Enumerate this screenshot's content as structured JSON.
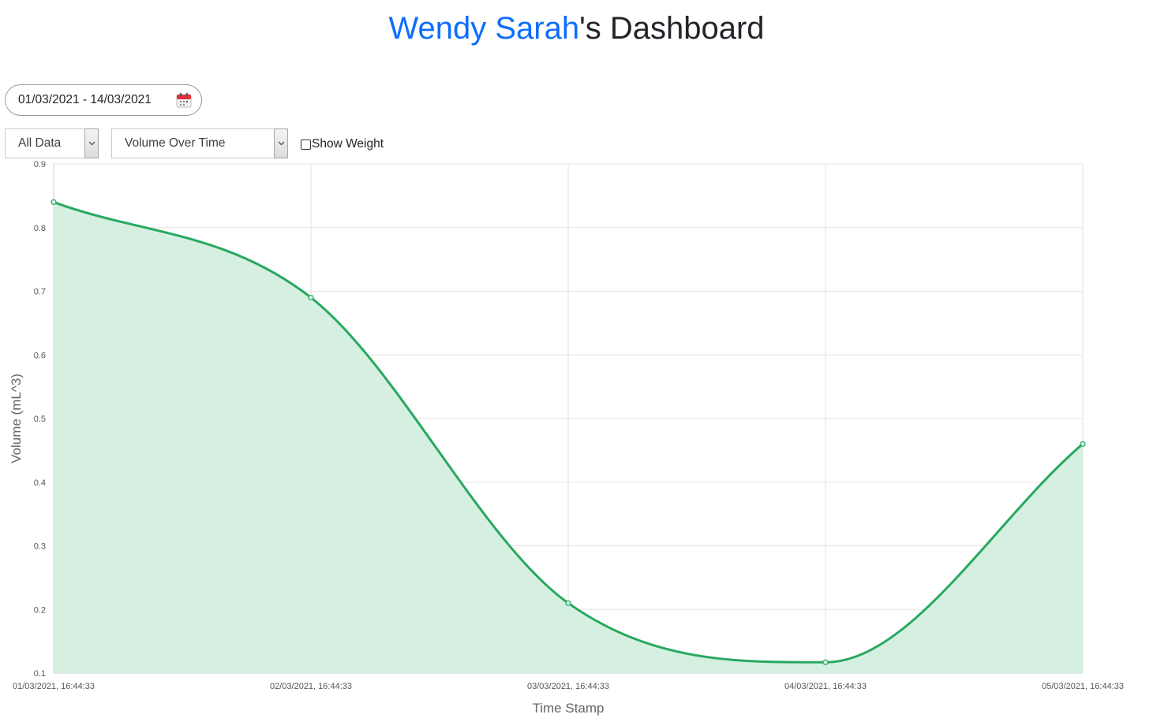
{
  "header": {
    "user_name": "Wendy Sarah",
    "title_suffix": "'s Dashboard"
  },
  "date_range": {
    "value": "01/03/2021 - 14/03/2021",
    "icon": "calendar-icon"
  },
  "filters": {
    "data_select": "All Data",
    "metric_select": "Volume Over Time",
    "show_weight_label": "Show Weight",
    "show_weight_checked": false
  },
  "colors": {
    "accent": "#0d6efd",
    "line": "#28a860",
    "fill": "#d5f0e0"
  },
  "chart_data": {
    "type": "line",
    "categories": [
      "01/03/2021, 16:44:33",
      "02/03/2021, 16:44:33",
      "03/03/2021, 16:44:33",
      "04/03/2021, 16:44:33",
      "05/03/2021, 16:44:33"
    ],
    "series": [
      {
        "values": [
          0.84,
          0.69,
          0.21,
          0.117,
          0.46
        ]
      }
    ],
    "xlabel": "Time Stamp",
    "ylabel": "Volume (mL^3)",
    "ylim": [
      0.1,
      0.9
    ],
    "yticks": [
      "0.1",
      "0.2",
      "0.3",
      "0.4",
      "0.5",
      "0.6",
      "0.7",
      "0.8",
      "0.9"
    ],
    "area_fill": true,
    "grid": true,
    "legend": "none"
  }
}
